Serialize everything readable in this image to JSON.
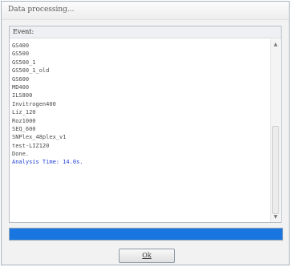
{
  "window": {
    "title": "Data processing..."
  },
  "events": {
    "label": "Event:",
    "lines": [
      "GS400",
      "GS500",
      "GS500_1",
      "GS500_1_old",
      "GS600",
      "MD400",
      "ILS800",
      "Invitrogen400",
      "Liz_120",
      "Roz1000",
      "SEQ_600",
      "SNPlex_48plex_v1",
      "test-LIZ120",
      "Done."
    ],
    "result": "Analysis Time: 14.0s."
  },
  "progress": {
    "fraction": 1.0,
    "color": "#1976e0"
  },
  "buttons": {
    "ok_label": "Ok"
  },
  "icons": {
    "scroll_up": "scroll-up-arrow-icon",
    "scroll_down": "scroll-down-arrow-icon"
  }
}
